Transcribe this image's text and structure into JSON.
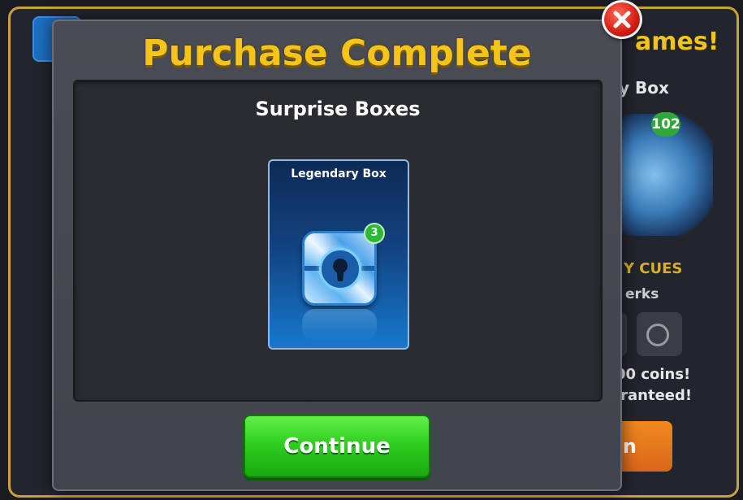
{
  "background": {
    "title_fragment": "ames!",
    "box_name_fragment": "y Box",
    "box_count": "102",
    "cues_fragment": "Y CUES",
    "perks_fragment": "erks",
    "coins_fragment": "00 coins!",
    "guaranteed_fragment": "aranteed!",
    "button_fragment": "n"
  },
  "modal": {
    "title": "Purchase Complete",
    "close_icon": "close-icon",
    "section_title": "Surprise Boxes",
    "item": {
      "name": "Legendary Box",
      "count": "3",
      "icon": "keyhole-icon"
    },
    "continue_label": "Continue"
  },
  "colors": {
    "title_yellow": "#f5c41a",
    "continue_green": "#2fcf1f",
    "close_red": "#d21d12",
    "card_blue": "#1778cc"
  }
}
